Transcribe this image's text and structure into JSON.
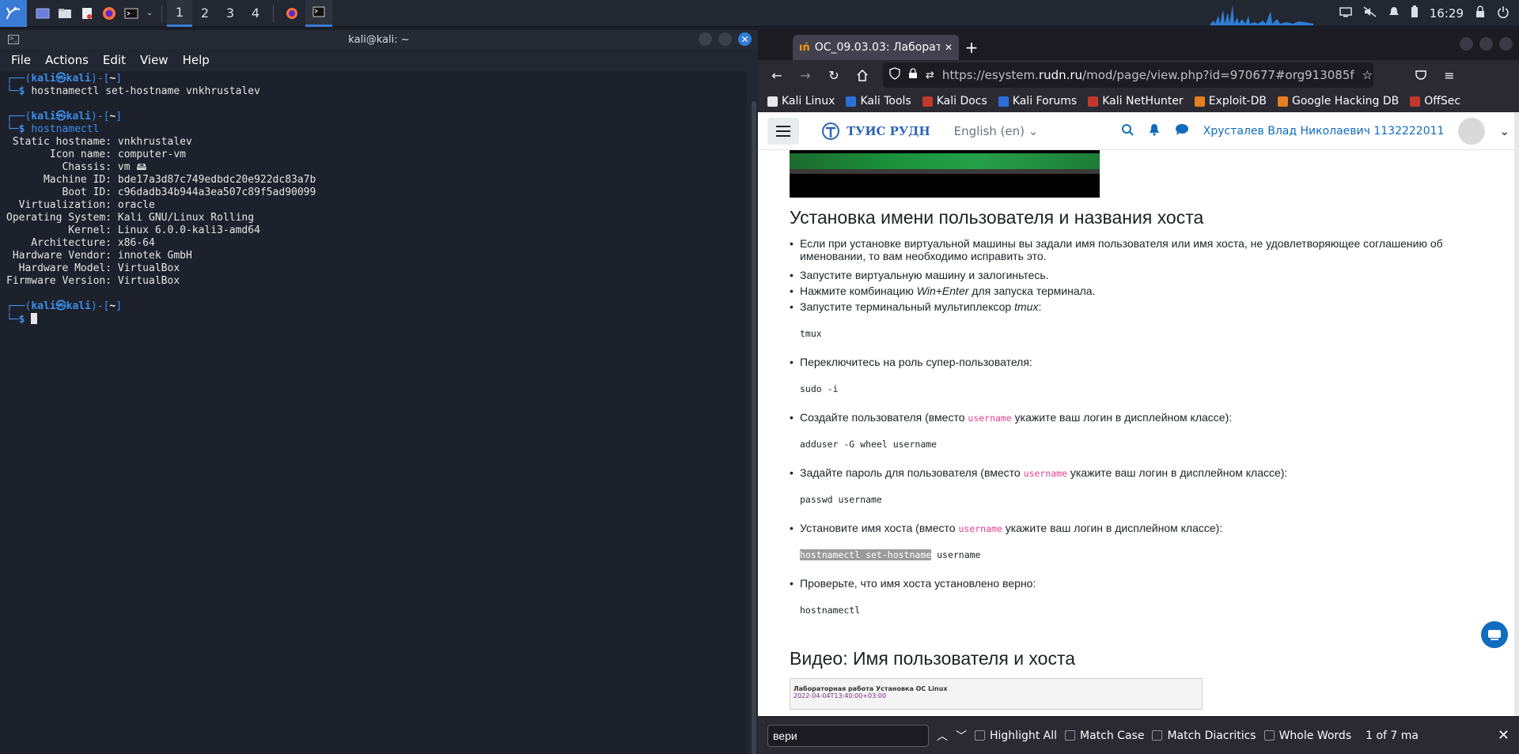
{
  "panel": {
    "workspaces": [
      "1",
      "2",
      "3",
      "4"
    ],
    "active_workspace": "1",
    "clock": "16:29"
  },
  "terminal": {
    "title": "kali@kali: ~",
    "menu": [
      "File",
      "Actions",
      "Edit",
      "View",
      "Help"
    ],
    "prompt": {
      "top": "┌──(",
      "user": "kali㉿kali",
      "mid": ")-[",
      "dir": "~",
      "end": "]",
      "bottom": "└─",
      "dollar": "$ "
    },
    "cmd1": "hostnamectl set-hostname vnkhrustalev",
    "cmd2": "hostnamectl",
    "output": [
      " Static hostname: vnkhrustalev",
      "       Icon name: computer-vm",
      "         Chassis: vm 🖴",
      "      Machine ID: bde17a3d87c749edbdc20e922dc83a7b",
      "         Boot ID: c96dadb34b944a3ea507c89f5ad90099",
      "  Virtualization: oracle",
      "Operating System: Kali GNU/Linux Rolling",
      "          Kernel: Linux 6.0.0-kali3-amd64",
      "    Architecture: x86-64",
      " Hardware Vendor: innotek GmbH",
      "  Hardware Model: VirtualBox",
      "Firmware Version: VirtualBox"
    ]
  },
  "browser": {
    "tab_title": "ОС_09.03.03: Лаборатор",
    "tab_favicon": "ıń",
    "url": {
      "prefix": "https://esystem.",
      "domain": "rudn.ru",
      "path": "/mod/page/view.php?id=970677#org913085f"
    },
    "bookmarks": [
      "Kali Linux",
      "Kali Tools",
      "Kali Docs",
      "Kali Forums",
      "Kali NetHunter",
      "Exploit-DB",
      "Google Hacking DB",
      "OffSec"
    ],
    "bookmark_colors": [
      "#e8e8e8",
      "#2c6ed5",
      "#c0392b",
      "#2c6ed5",
      "#c0392b",
      "#e67e22",
      "#e67e22",
      "#c0392b"
    ]
  },
  "site": {
    "logo_text": "ТУИС РУДН",
    "language": "English (en)",
    "user_name": "Хрусталев Влад Николаевич 1132222011"
  },
  "content": {
    "heading1": "Установка имени пользователя и названия хоста",
    "item1a": "Если при установке виртуальной машины вы задали имя пользователя или имя хоста, не удовлетворяющее соглашению об",
    "item1b": "именовании, то вам необходимо исправить это.",
    "item2": "Запустите виртуальную машину и залогиньтесь.",
    "item3_pre": "Нажмите комбинацию ",
    "item3_em": "Win+Enter",
    "item3_post": " для запуска терминала.",
    "item4_pre": "Запустите терминальный мультиплексор ",
    "item4_em": "tmux",
    "item4_post": ":",
    "code1": "tmux",
    "item5": "Переключитесь на роль супер-пользователя:",
    "code2": "sudo -i",
    "item6_pre": "Создайте пользователя (вместо ",
    "item6_code": "username",
    "item6_post": " укажите ваш логин в дисплейном классе):",
    "code3": "adduser -G wheel username",
    "item7_pre": "Задайте пароль для пользователя (вместо ",
    "item7_code": "username",
    "item7_post": " укажите ваш логин в дисплейном классе):",
    "code4": "passwd username",
    "item8_pre": "Установите имя хоста (вместо ",
    "item8_code": "username",
    "item8_post": " укажите ваш логин в дисплейном классе):",
    "code5_hl": "hostnamectl set-hostname",
    "code5_rest": " username",
    "item9": "Проверьте, что имя хоста установлено верно:",
    "code6": "hostnamectl",
    "heading2": "Видео: Имя пользователя и хоста",
    "video_title": "Лабораторная работа Установка ОС Linux",
    "video_date": "2022-04-04T13:40:00+03:00"
  },
  "findbar": {
    "query": "вери",
    "highlight_all": "Highlight All",
    "match_case": "Match Case",
    "match_diacritics": "Match Diacritics",
    "whole_words": "Whole Words",
    "result": "1 of 7 ma"
  }
}
